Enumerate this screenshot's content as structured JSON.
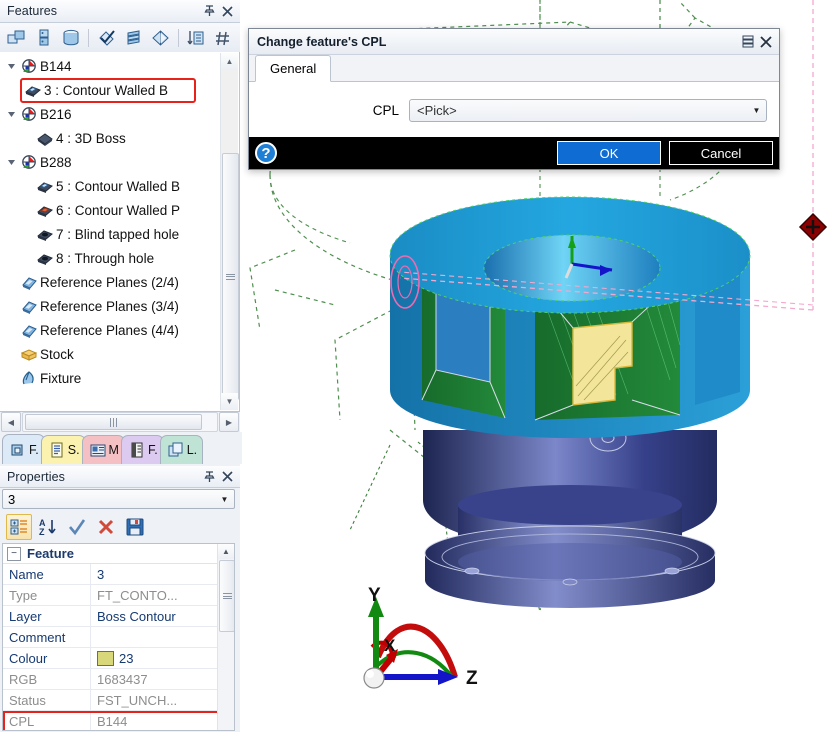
{
  "features_panel": {
    "title": "Features",
    "pin_icon": "pin-icon",
    "close_icon": "close-icon",
    "toolbar": [
      {
        "name": "new-feature-icon",
        "tip": "New feature"
      },
      {
        "name": "feature-properties-icon",
        "tip": "Feature properties"
      },
      {
        "name": "delete-feature-icon",
        "tip": "Delete feature"
      },
      {
        "name": "check-feature-icon",
        "tip": "Check"
      },
      {
        "name": "reorder-features-icon",
        "tip": "Reorder"
      },
      {
        "name": "mirror-feature-icon",
        "tip": "Mirror"
      },
      {
        "name": "sort-features-icon",
        "tip": "Sort"
      },
      {
        "name": "renumber-features-icon",
        "tip": "Renumber"
      }
    ],
    "tree": [
      {
        "label": "B144",
        "icon": "cpl-icon",
        "depth": 0,
        "expander": "collapse",
        "selected": false
      },
      {
        "label": "3 :  Contour Walled B",
        "icon": "contour-walled-boss-icon",
        "depth": 1,
        "expander": "none",
        "selected": true
      },
      {
        "label": "B216",
        "icon": "cpl-icon",
        "depth": 0,
        "expander": "collapse",
        "selected": false
      },
      {
        "label": "4 :  3D Boss",
        "icon": "boss-3d-icon",
        "depth": 1,
        "expander": "none",
        "selected": false
      },
      {
        "label": "B288",
        "icon": "cpl-icon",
        "depth": 0,
        "expander": "collapse",
        "selected": false
      },
      {
        "label": "5 :  Contour Walled B",
        "icon": "contour-walled-boss-icon",
        "depth": 1,
        "expander": "none",
        "selected": false
      },
      {
        "label": "6 :  Contour Walled P",
        "icon": "contour-walled-pocket-icon",
        "depth": 1,
        "expander": "none",
        "selected": false
      },
      {
        "label": "7 :  Blind tapped hole",
        "icon": "hole-icon",
        "depth": 1,
        "expander": "none",
        "selected": false
      },
      {
        "label": "8 :  Through hole",
        "icon": "hole-icon",
        "depth": 1,
        "expander": "none",
        "selected": false
      },
      {
        "label": "Reference Planes (2/4)",
        "icon": "reference-plane-icon",
        "depth": 0,
        "expander": "none",
        "selected": false
      },
      {
        "label": "Reference Planes (3/4)",
        "icon": "reference-plane-icon",
        "depth": 0,
        "expander": "none",
        "selected": false
      },
      {
        "label": "Reference Planes (4/4)",
        "icon": "reference-plane-icon",
        "depth": 0,
        "expander": "none",
        "selected": false
      },
      {
        "label": "Stock",
        "icon": "stock-icon",
        "depth": 0,
        "expander": "none",
        "selected": false
      },
      {
        "label": "Fixture",
        "icon": "fixture-icon",
        "depth": 0,
        "expander": "none",
        "selected": false
      }
    ],
    "hscroll": {
      "left_arrow": "◀",
      "right_arrow": "▶",
      "grip": "|||"
    }
  },
  "dock_tabs": [
    {
      "label": "F.",
      "icon": "features-tab-icon",
      "color": "#dceaf7",
      "active": true
    },
    {
      "label": "S.",
      "icon": "setup-tab-icon",
      "color": "#fbf2b0"
    },
    {
      "label": "M",
      "icon": "machining-tab-icon",
      "color": "#f5c0c4"
    },
    {
      "label": "F.",
      "icon": "file-tab-icon",
      "color": "#dccaf0"
    },
    {
      "label": "L.",
      "icon": "layers-tab-icon",
      "color": "#bfe3d4"
    }
  ],
  "properties_panel": {
    "title": "Properties",
    "pin_icon": "pin-icon",
    "close_icon": "close-icon",
    "selector_value": "3",
    "toolbar": [
      {
        "name": "categorized-view-icon",
        "active": true
      },
      {
        "name": "alphabetic-sort-icon",
        "active": false
      },
      {
        "name": "apply-check-icon",
        "active": false
      },
      {
        "name": "cancel-x-icon",
        "active": false
      },
      {
        "name": "save-disk-icon",
        "active": false
      }
    ],
    "group_header": "Feature",
    "rows": [
      {
        "key": "Name",
        "value": "3",
        "dim": false,
        "highlight": false
      },
      {
        "key": "Type",
        "value": "FT_CONTO...",
        "dim": true,
        "highlight": false
      },
      {
        "key": "Layer",
        "value": "Boss Contour",
        "dim": false,
        "highlight": false
      },
      {
        "key": "Comment",
        "value": "",
        "dim": false,
        "highlight": false
      },
      {
        "key": "Colour",
        "value": "23",
        "dim": false,
        "highlight": false,
        "swatch": "#d8d87a"
      },
      {
        "key": "RGB",
        "value": "1683437",
        "dim": true,
        "highlight": false
      },
      {
        "key": "Status",
        "value": "FST_UNCH...",
        "dim": true,
        "highlight": false
      },
      {
        "key": "CPL",
        "value": "B144",
        "dim": true,
        "highlight": true
      }
    ]
  },
  "dialog": {
    "title": "Change feature's CPL",
    "menu_icon": "dialog-menu-icon",
    "close_icon": "close-icon",
    "tabs": [
      {
        "label": "General",
        "active": true
      }
    ],
    "field_label": "CPL",
    "field_value": "<Pick>",
    "help_icon": "?",
    "ok_label": "OK",
    "cancel_label": "Cancel",
    "ok_color": "#0f6cd2"
  },
  "viewport": {
    "axis_triad": {
      "x_label": "X",
      "y_label": "Y",
      "z_label": "Z",
      "x_color": "#c00000",
      "y_color": "#128a12",
      "z_color": "#1414c8"
    },
    "colors": {
      "part_top_cyan": "#1f9ed6",
      "part_pocket_green": "#1e7a33",
      "part_body_navy": "#2e3f80",
      "feature_highlight_yellow": "#f3e59a",
      "stock_wireframe": "#4f8f4f",
      "leader_pink": "#f08ec0",
      "marker_red": "#8b0000"
    }
  }
}
